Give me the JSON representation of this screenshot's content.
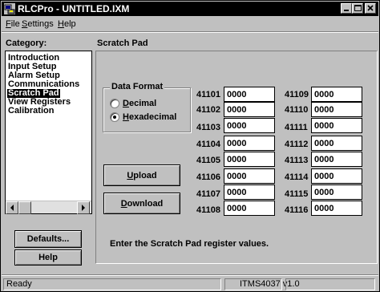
{
  "window": {
    "title": "RLCPro - UNTITLED.IXM",
    "icon": "app-icon",
    "controls": [
      "minimize-icon",
      "maximize-icon",
      "close-icon"
    ]
  },
  "menu": {
    "file": {
      "label": "File",
      "mnemonic": "F",
      "rest": "ile"
    },
    "settings": {
      "label": "Settings",
      "mnemonic": "S",
      "rest": "ettings"
    },
    "help": {
      "label": "Help",
      "mnemonic": "H",
      "rest": "elp"
    }
  },
  "sidebar": {
    "category_label": "Category:",
    "items": [
      {
        "label": "Introduction",
        "selected": false
      },
      {
        "label": "Input Setup",
        "selected": false
      },
      {
        "label": "Alarm Setup",
        "selected": false
      },
      {
        "label": "Communications",
        "selected": false
      },
      {
        "label": "Scratch Pad",
        "selected": true
      },
      {
        "label": "View Registers",
        "selected": false
      },
      {
        "label": "Calibration",
        "selected": false
      }
    ],
    "defaults_button": "Defaults...",
    "help_button": "Help"
  },
  "panel": {
    "title": "Scratch Pad",
    "data_format": {
      "legend": "Data Format",
      "options": [
        {
          "label": "Decimal",
          "mnemonic": "D",
          "rest": "ecimal",
          "checked": false
        },
        {
          "label": "Hexadecimal",
          "mnemonic": "H",
          "rest": "exadecimal",
          "checked": true
        }
      ]
    },
    "upload_button": {
      "mnemonic": "U",
      "rest": "pload"
    },
    "download_button": {
      "mnemonic": "D",
      "rest": "ownload"
    },
    "registers_left": [
      {
        "id": "41101",
        "value": "0000"
      },
      {
        "id": "41102",
        "value": "0000"
      },
      {
        "id": "41103",
        "value": "0000"
      },
      {
        "id": "41104",
        "value": "0000"
      },
      {
        "id": "41105",
        "value": "0000"
      },
      {
        "id": "41106",
        "value": "0000"
      },
      {
        "id": "41107",
        "value": "0000"
      },
      {
        "id": "41108",
        "value": "0000"
      }
    ],
    "registers_right": [
      {
        "id": "41109",
        "value": "0000"
      },
      {
        "id": "41110",
        "value": "0000"
      },
      {
        "id": "41111",
        "value": "0000"
      },
      {
        "id": "41112",
        "value": "0000"
      },
      {
        "id": "41113",
        "value": "0000"
      },
      {
        "id": "41114",
        "value": "0000"
      },
      {
        "id": "41115",
        "value": "0000"
      },
      {
        "id": "41116",
        "value": "0000"
      }
    ],
    "hint": "Enter the Scratch Pad register values."
  },
  "status": {
    "left": "Ready",
    "version": "ITMS4037 v1.0",
    "right": ""
  }
}
